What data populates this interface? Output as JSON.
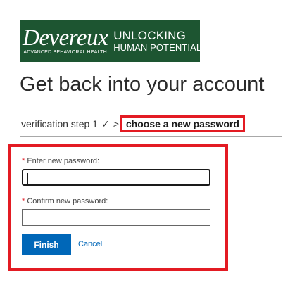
{
  "logo": {
    "brand": "Devereux",
    "subtitle": "ADVANCED BEHAVIORAL HEALTH",
    "tagline_line1": "UNLOCKING",
    "tagline_line2": "HUMAN POTENTIAL™"
  },
  "page_title": "Get back into your account",
  "steps": {
    "previous_label": "verification step 1",
    "check_mark": "✓",
    "separator": ">",
    "current_label": "choose a new password"
  },
  "form": {
    "required_marker": "*",
    "new_password_label": "Enter new password:",
    "new_password_value": "",
    "confirm_password_label": "Confirm new password:",
    "confirm_password_value": "",
    "finish_label": "Finish",
    "cancel_label": "Cancel"
  },
  "colors": {
    "brand_green": "#1d5531",
    "accent_blue": "#0067b8",
    "highlight_red": "#e31b23"
  }
}
